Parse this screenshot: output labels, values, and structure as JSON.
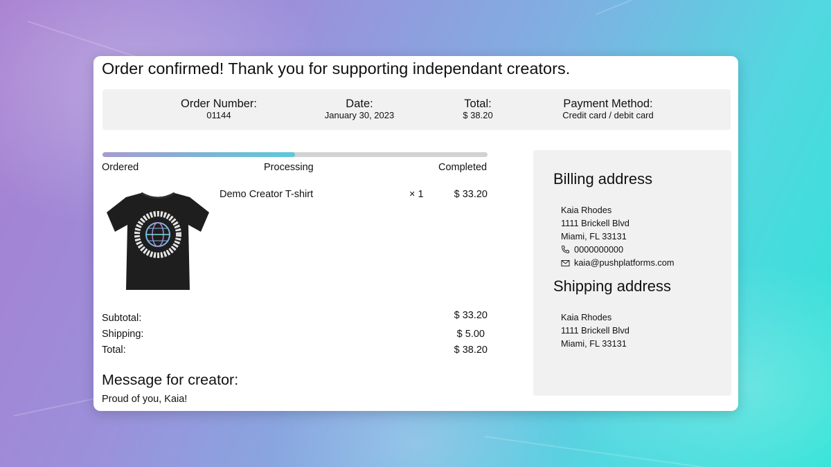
{
  "headline": "Order confirmed! Thank you for supporting independant creators.",
  "summary": {
    "order_number_label": "Order Number:",
    "order_number": "01144",
    "date_label": "Date:",
    "date": "January 30, 2023",
    "total_label": "Total:",
    "total": "$ 38.20",
    "payment_label": "Payment Method:",
    "payment": "Credit card / debit card"
  },
  "progress": {
    "fraction": 0.5,
    "steps": [
      "Ordered",
      "Processing",
      "Completed"
    ],
    "current_step": "Processing"
  },
  "item": {
    "name": "Demo Creator T-shirt",
    "quantity": "× 1",
    "price": "$ 33.20",
    "image_icon": "t-shirt-image",
    "image_text": "BREAK THROUGH THE NOISE"
  },
  "totals": {
    "subtotal_label": "Subtotal:",
    "subtotal": "$ 33.20",
    "shipping_label": "Shipping:",
    "shipping": "$ 5.00",
    "total_label": "Total:",
    "total": "$ 38.20"
  },
  "message": {
    "heading": "Message for creator:",
    "text": "Proud of you, Kaia!"
  },
  "billing": {
    "heading": "Billing address",
    "name": "Kaia Rhodes",
    "street": "1111 Brickell Blvd",
    "city": "Miami, FL 33131",
    "phone": "0000000000",
    "email": "kaia@pushplatforms.com",
    "phone_icon": "phone-icon",
    "email_icon": "envelope-icon"
  },
  "shipping_address": {
    "heading": "Shipping address",
    "name": "Kaia Rhodes",
    "street": "1111 Brickell Blvd",
    "city": "Miami, FL 33131"
  },
  "colors": {
    "progress_start": "#a79bd0",
    "progress_end": "#5bc9da",
    "panel_bg": "#f1f1f1",
    "card_bg": "#ffffff"
  }
}
